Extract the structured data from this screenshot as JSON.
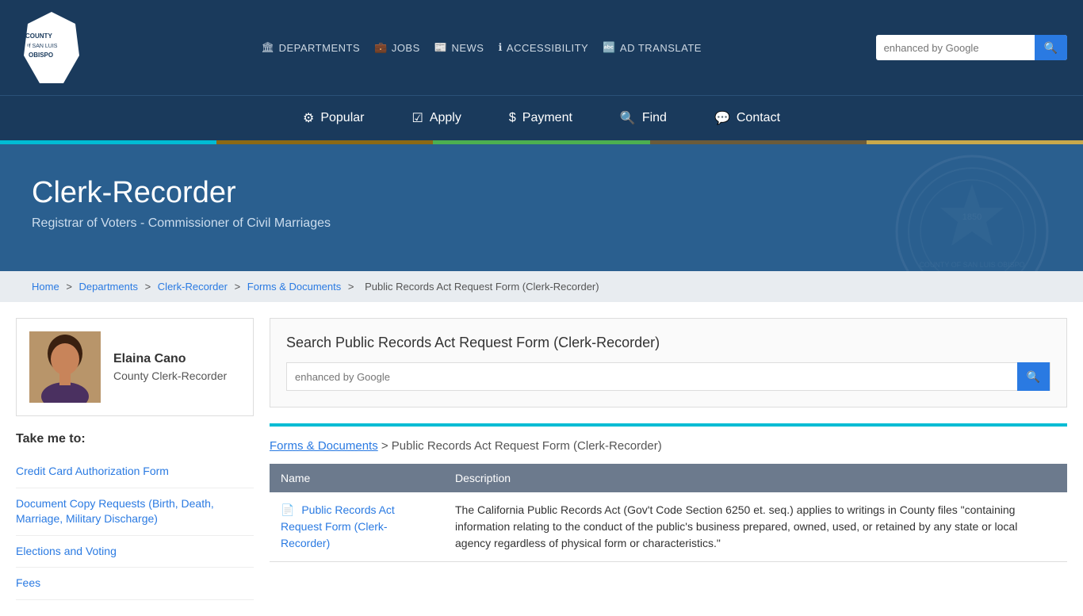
{
  "site": {
    "title": "County of San Luis Obispo",
    "logo_text": "COUNTY\nSAN LUIS\nOBISPO"
  },
  "top_nav": {
    "links": [
      {
        "id": "departments",
        "label": "DEPARTMENTS",
        "icon": "🏛"
      },
      {
        "id": "jobs",
        "label": "JOBS",
        "icon": "💼"
      },
      {
        "id": "news",
        "label": "NEWS",
        "icon": "📰"
      },
      {
        "id": "accessibility",
        "label": "ACCESSIBILITY",
        "icon": "ℹ"
      },
      {
        "id": "translate",
        "label": "AD TRANSLATE",
        "icon": "🔤"
      }
    ],
    "search_placeholder": "enhanced by Google"
  },
  "main_nav": {
    "items": [
      {
        "id": "popular",
        "label": "Popular",
        "icon": "⚙"
      },
      {
        "id": "apply",
        "label": "Apply",
        "icon": "☑"
      },
      {
        "id": "payment",
        "label": "Payment",
        "icon": "$"
      },
      {
        "id": "find",
        "label": "Find",
        "icon": "🔍"
      },
      {
        "id": "contact",
        "label": "Contact",
        "icon": "💬"
      }
    ],
    "accent_colors": [
      "#00bcd4",
      "#8b6914",
      "#4caf50",
      "#6b5b3a",
      "#c8a84b"
    ]
  },
  "hero": {
    "title": "Clerk-Recorder",
    "subtitle": "Registrar of Voters - Commissioner of Civil Marriages"
  },
  "breadcrumb": {
    "items": [
      {
        "label": "Home",
        "href": "#"
      },
      {
        "label": "Departments",
        "href": "#"
      },
      {
        "label": "Clerk-Recorder",
        "href": "#"
      },
      {
        "label": "Forms & Documents",
        "href": "#"
      },
      {
        "label": "Public Records Act Request Form (Clerk-Recorder)",
        "href": null
      }
    ]
  },
  "official": {
    "name": "Elaina Cano",
    "title": "County Clerk-Recorder"
  },
  "sidebar": {
    "heading": "Take me to:",
    "links": [
      {
        "label": "Credit Card Authorization Form",
        "href": "#"
      },
      {
        "label": "Document Copy Requests (Birth, Death, Marriage, Military Discharge)",
        "href": "#"
      },
      {
        "label": "Elections and Voting",
        "href": "#"
      },
      {
        "label": "Fees",
        "href": "#"
      }
    ]
  },
  "content": {
    "search_heading": "Search Public Records Act Request Form (Clerk-Recorder)",
    "search_placeholder": "enhanced by Google",
    "trail": {
      "link_label": "Forms & Documents",
      "rest": " > Public Records Act Request Form (Clerk-Recorder)"
    },
    "table": {
      "headers": [
        "Name",
        "Description"
      ],
      "rows": [
        {
          "name": "Public Records Act Request Form (Clerk-Recorder)",
          "name_href": "#",
          "description": "The California Public Records Act (Gov't Code Section 6250 et. seq.) applies to writings in County files \"containing information relating to the conduct of the public's business prepared, owned, used, or retained by any state or local agency regardless of physical form or characteristics.\""
        }
      ]
    }
  }
}
